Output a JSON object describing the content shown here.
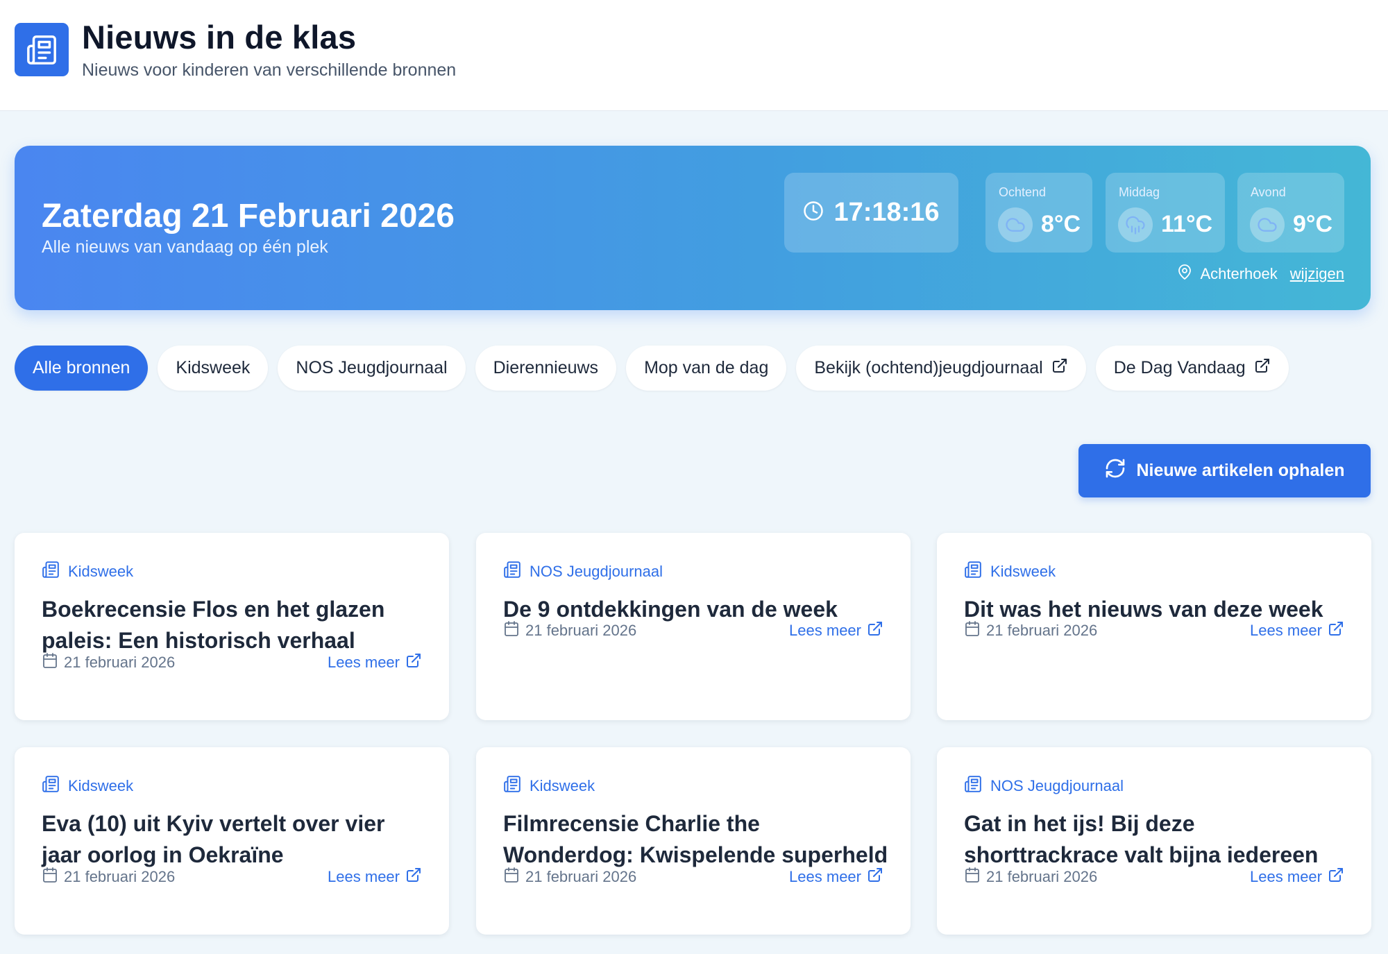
{
  "header": {
    "title": "Nieuws in de klas",
    "subtitle": "Nieuws voor kinderen van verschillende bronnen",
    "logo_icon": "newspaper-icon"
  },
  "hero": {
    "date": "Zaterdag 21 Februari 2026",
    "subtitle": "Alle nieuws van vandaag op één plek",
    "time": "17:18:16",
    "weather": [
      {
        "label": "Ochtend",
        "temp": "8°C",
        "icon": "cloud-icon"
      },
      {
        "label": "Middag",
        "temp": "11°C",
        "icon": "cloud-rain-icon"
      },
      {
        "label": "Avond",
        "temp": "9°C",
        "icon": "cloud-icon"
      }
    ],
    "location": "Achterhoek",
    "change_label": "wijzigen"
  },
  "filters": [
    {
      "label": "Alle bronnen",
      "active": true,
      "external": false
    },
    {
      "label": "Kidsweek",
      "active": false,
      "external": false
    },
    {
      "label": "NOS Jeugdjournaal",
      "active": false,
      "external": false
    },
    {
      "label": "Dierennieuws",
      "active": false,
      "external": false
    },
    {
      "label": "Mop van de dag",
      "active": false,
      "external": false
    },
    {
      "label": "Bekijk (ochtend)jeugdjournaal",
      "active": false,
      "external": true
    },
    {
      "label": "De Dag Vandaag",
      "active": false,
      "external": true
    }
  ],
  "refresh_button": "Nieuwe artikelen ophalen",
  "articles": [
    {
      "source": "Kidsweek",
      "title": "Boekrecensie Flos en het glazen paleis: Een historisch verhaal",
      "date": "21 februari 2026",
      "link": "Lees meer"
    },
    {
      "source": "NOS Jeugdjournaal",
      "title": "De 9 ontdekkingen van de week",
      "date": "21 februari 2026",
      "link": "Lees meer"
    },
    {
      "source": "Kidsweek",
      "title": "Dit was het nieuws van deze week",
      "date": "21 februari 2026",
      "link": "Lees meer"
    },
    {
      "source": "Kidsweek",
      "title": "Eva (10) uit Kyiv vertelt over vier jaar oorlog in Oekraïne",
      "date": "21 februari 2026",
      "link": "Lees meer"
    },
    {
      "source": "Kidsweek",
      "title": "Filmrecensie Charlie the Wonderdog: Kwispelende superheld",
      "date": "21 februari 2026",
      "link": "Lees meer"
    },
    {
      "source": "NOS Jeugdjournaal",
      "title": "Gat in het ijs! Bij deze shorttrackrace valt bijna iedereen",
      "date": "21 februari 2026",
      "link": "Lees meer"
    }
  ],
  "colors": {
    "primary": "#2f6fe8",
    "background": "#eff6fb",
    "hero_gradient_start": "#4a86f0",
    "hero_gradient_end": "#44b7d6"
  }
}
